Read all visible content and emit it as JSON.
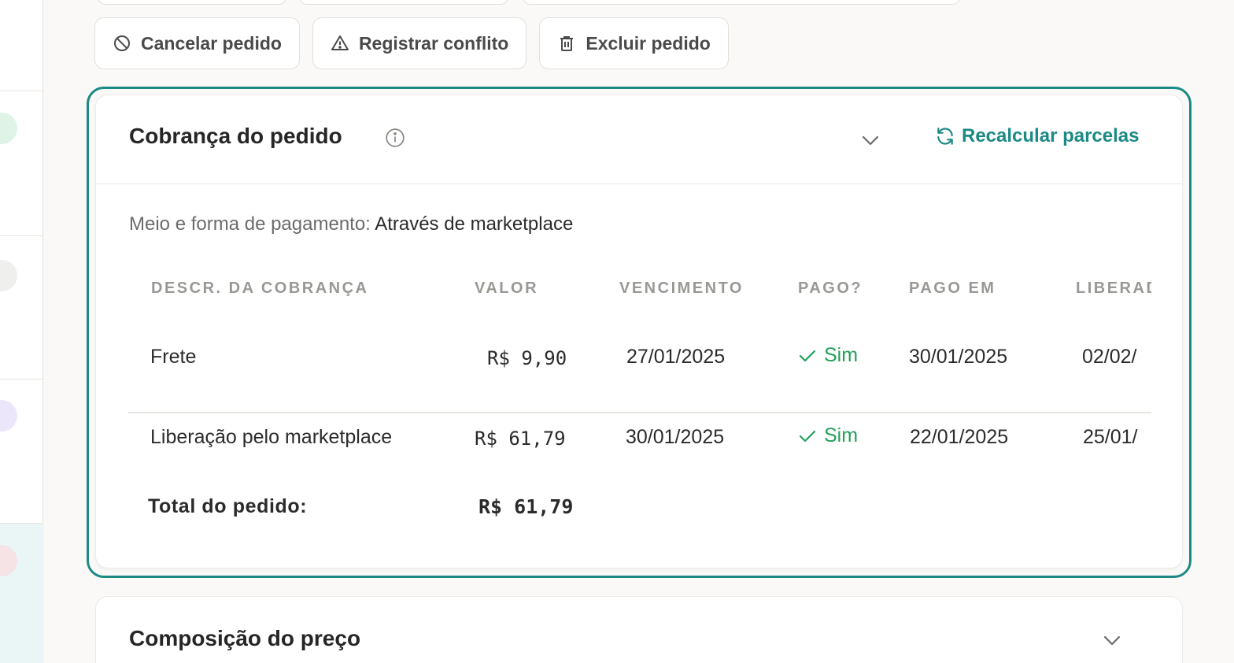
{
  "actions": {
    "cancel": "Cancelar pedido",
    "conflict": "Registrar conflito",
    "delete": "Excluir pedido"
  },
  "billing": {
    "title": "Cobrança do pedido",
    "recalc": "Recalcular parcelas",
    "payment_label": "Meio e forma de pagamento:",
    "payment_value": "Através de marketplace",
    "columns": [
      "DESCR. DA COBRANÇA",
      "VALOR",
      "VENCIMENTO",
      "PAGO?",
      "PAGO EM",
      "LIBERAD"
    ],
    "rows": [
      {
        "descr": "Frete",
        "valor": "R$ 9,90",
        "vencimento": "27/01/2025",
        "pago": "Sim",
        "pago_em": "30/01/2025",
        "liberado": "02/02/"
      },
      {
        "descr": "Liberação pelo marketplace",
        "valor": "R$ 61,79",
        "vencimento": "30/01/2025",
        "pago": "Sim",
        "pago_em": "22/01/2025",
        "liberado": "25/01/"
      }
    ],
    "total_label": "Total do pedido:",
    "total_value": "R$ 61,79"
  },
  "price": {
    "title": "Composição do preço"
  },
  "colors": {
    "accent": "#1b8a84",
    "success": "#22a05a",
    "muted": "#9a9894"
  }
}
